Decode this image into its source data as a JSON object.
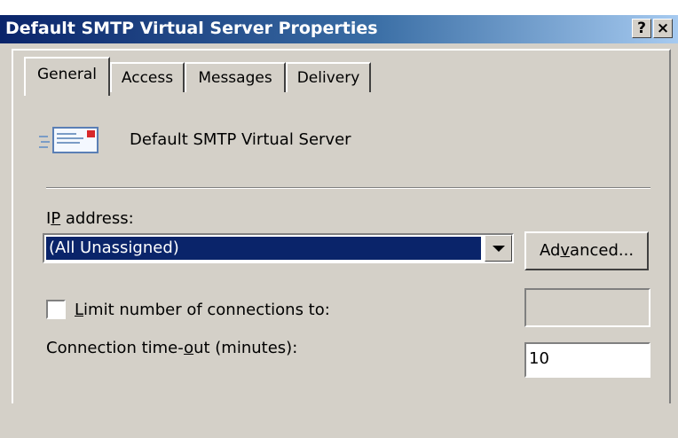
{
  "window": {
    "title": "Default SMTP Virtual Server Properties",
    "help_label": "?",
    "close_label": "×"
  },
  "tabs": [
    {
      "label": "General",
      "active": true
    },
    {
      "label": "Access",
      "active": false
    },
    {
      "label": "Messages",
      "active": false
    },
    {
      "label": "Delivery",
      "active": false
    }
  ],
  "general": {
    "server_icon": "mail-server-icon",
    "server_name": "Default SMTP Virtual Server",
    "ip_label_mnemonic": "I",
    "ip_label_key": "P",
    "ip_label_rest": " address:",
    "ip_value": "(All Unassigned)",
    "advanced_pre": "Ad",
    "advanced_key": "v",
    "advanced_post": "anced...",
    "limit_checked": false,
    "limit_key": "L",
    "limit_rest": "imit number of connections to:",
    "limit_value": "",
    "timeout_pre": "Connection time-",
    "timeout_key": "o",
    "timeout_post": "ut (minutes):",
    "timeout_value": "10"
  }
}
